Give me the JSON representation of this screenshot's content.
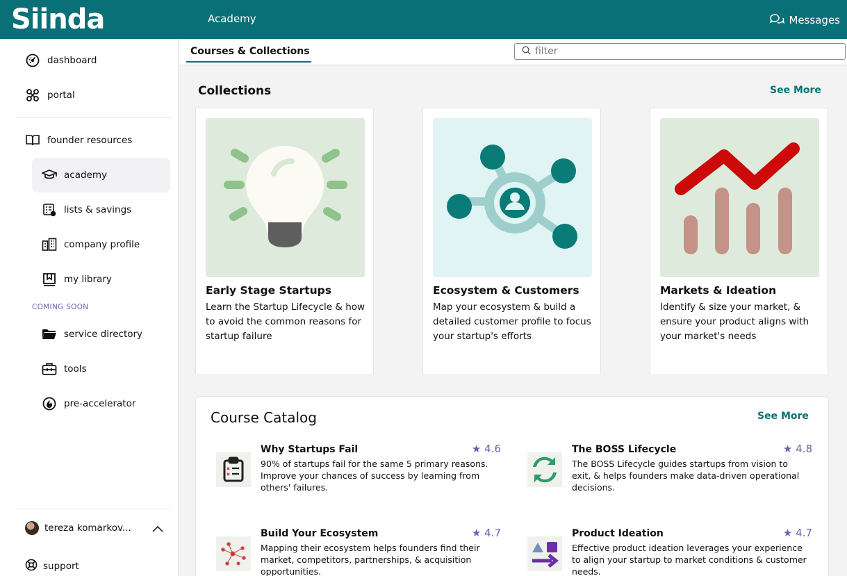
{
  "app": {
    "logo": "Siinda",
    "section": "Academy",
    "messages_label": "Messages"
  },
  "sidebar": {
    "items": [
      {
        "label": "dashboard",
        "icon": "dashboard-icon"
      },
      {
        "label": "portal",
        "icon": "portal-icon"
      },
      {
        "label": "founder resources",
        "icon": "book-icon"
      },
      {
        "label": "academy",
        "icon": "graduation-cap-icon"
      },
      {
        "label": "lists & savings",
        "icon": "list-icon"
      },
      {
        "label": "company profile",
        "icon": "building-icon"
      },
      {
        "label": "my library",
        "icon": "bookmark-icon"
      },
      {
        "label": "service directory",
        "icon": "folder-icon"
      },
      {
        "label": "tools",
        "icon": "toolbox-icon"
      },
      {
        "label": "pre-accelerator",
        "icon": "flame-icon"
      }
    ],
    "coming_soon": "COMING SOON",
    "user_name": "tereza komarkov...",
    "support": "support"
  },
  "subheader": {
    "tab": "Courses & Collections",
    "filter_placeholder": "filter"
  },
  "collections": {
    "heading": "Collections",
    "see_more": "See More",
    "cards": [
      {
        "title": "Early Stage Startups",
        "desc": "Learn the Startup Lifecycle & how to avoid the common reasons for startup failure"
      },
      {
        "title": "Ecosystem & Customers",
        "desc": "Map your ecosystem & build a detailed customer profile to focus your startup's efforts"
      },
      {
        "title": "Markets & Ideation",
        "desc": "Identify & size your market, & ensure your product aligns with your market's needs"
      }
    ]
  },
  "catalog": {
    "heading": "Course Catalog",
    "see_more": "See More",
    "courses": [
      {
        "title": "Why Startups Fail",
        "rating": "★ 4.6",
        "desc": "90% of startups fail for the same 5 primary reasons. Improve your chances of success by learning from others' failures."
      },
      {
        "title": "The BOSS Lifecycle",
        "rating": "★ 4.8",
        "desc": "The BOSS Lifecycle guides startups from vision to exit, & helps founders make data-driven operational decisions."
      },
      {
        "title": "Build Your Ecosystem",
        "rating": "★ 4.7",
        "desc": "Mapping their ecosystem helps founders find their market, competitors, partnerships, & acquisition opportunities."
      },
      {
        "title": "Product Ideation",
        "rating": "★ 4.7",
        "desc": "Effective product ideation leverages your experience to align your startup to market conditions & customer needs."
      }
    ]
  },
  "colors": {
    "brand": "#0a7078",
    "accent": "#6c5fb0"
  }
}
